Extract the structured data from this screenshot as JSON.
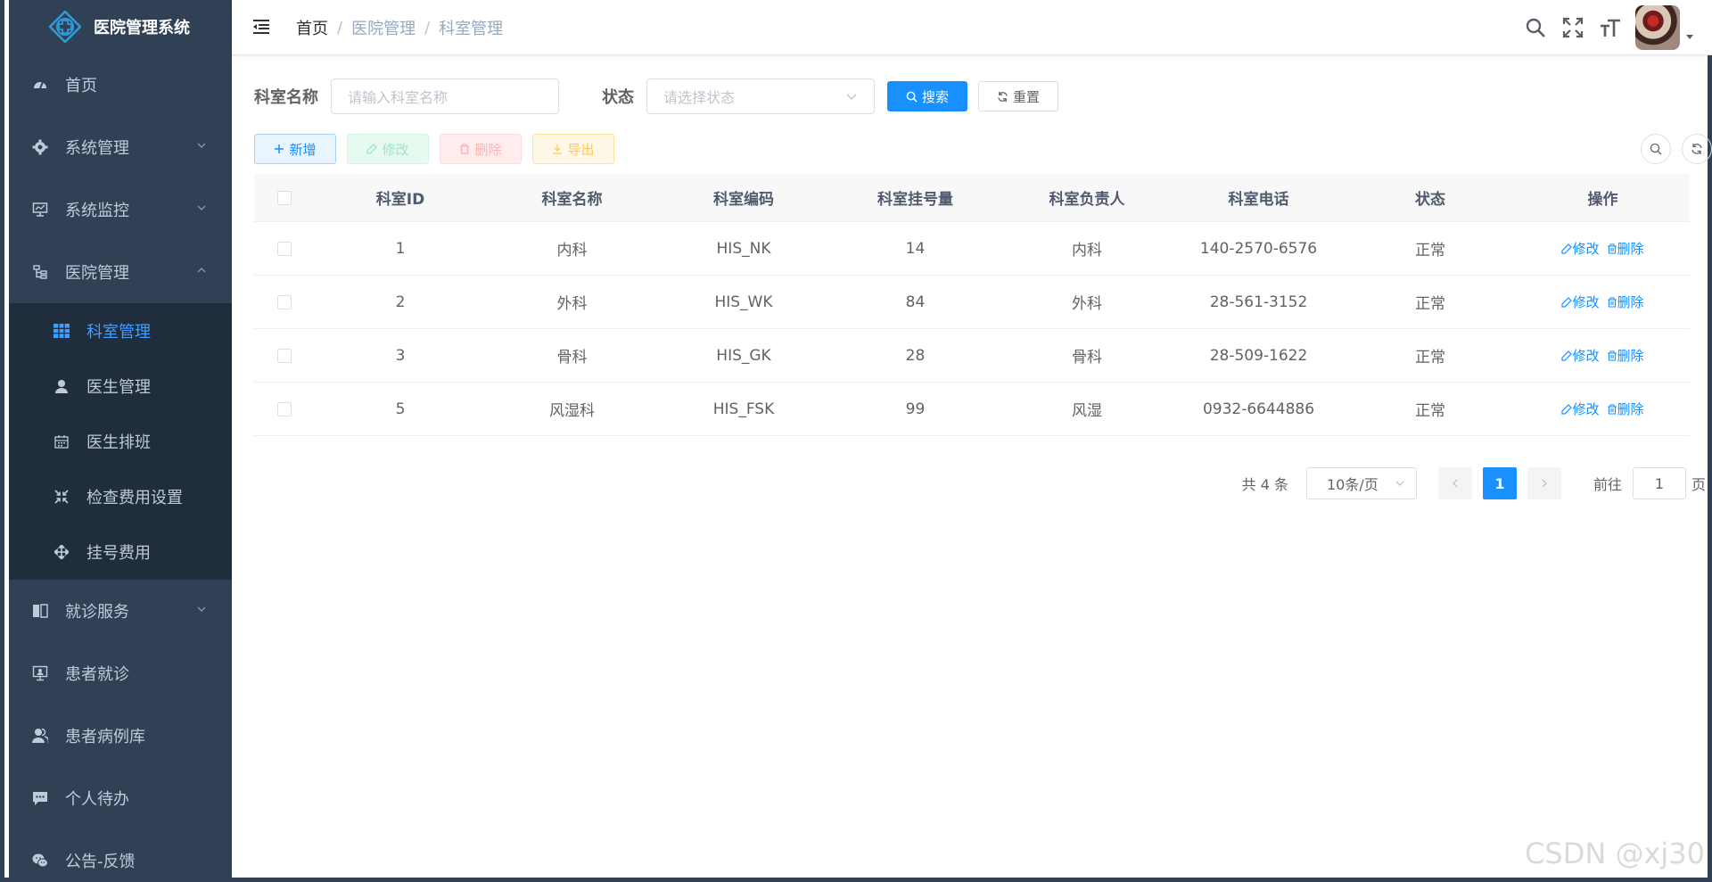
{
  "app": {
    "title": "医院管理系统"
  },
  "sidebar": {
    "items": [
      {
        "label": "首页",
        "icon": "dashboard-icon"
      },
      {
        "label": "系统管理",
        "icon": "gear-icon",
        "expandable": true
      },
      {
        "label": "系统监控",
        "icon": "monitor-icon",
        "expandable": true
      },
      {
        "label": "医院管理",
        "icon": "tree-icon",
        "expandable": true,
        "expanded": true
      },
      {
        "label": "就诊服务",
        "icon": "book-icon",
        "expandable": true
      },
      {
        "label": "患者就诊",
        "icon": "screen-icon"
      },
      {
        "label": "患者病例库",
        "icon": "peoples-icon"
      },
      {
        "label": "个人待办",
        "icon": "message-icon"
      },
      {
        "label": "公告-反馈",
        "icon": "wechat-icon"
      }
    ],
    "submenu": [
      {
        "label": "科室管理",
        "icon": "grid-icon",
        "active": true
      },
      {
        "label": "医生管理",
        "icon": "user-icon"
      },
      {
        "label": "医生排班",
        "icon": "calendar-icon"
      },
      {
        "label": "检查费用设置",
        "icon": "shrink-icon"
      },
      {
        "label": "挂号费用",
        "icon": "move-icon"
      }
    ]
  },
  "breadcrumb": {
    "home": "首页",
    "level1": "医院管理",
    "level2": "科室管理",
    "sep": "/"
  },
  "search": {
    "name_label": "科室名称",
    "name_placeholder": "请输入科室名称",
    "status_label": "状态",
    "status_placeholder": "请选择状态",
    "search_btn": "搜索",
    "reset_btn": "重置"
  },
  "toolbar": {
    "add": "新增",
    "edit": "修改",
    "delete": "删除",
    "export": "导出"
  },
  "table": {
    "headers": [
      "科室ID",
      "科室名称",
      "科室编码",
      "科室挂号量",
      "科室负责人",
      "科室电话",
      "状态",
      "操作"
    ],
    "rows": [
      {
        "id": "1",
        "name": "内科",
        "code": "HIS_NK",
        "count": "14",
        "leader": "内科",
        "phone": "140-2570-6576",
        "status": "正常"
      },
      {
        "id": "2",
        "name": "外科",
        "code": "HIS_WK",
        "count": "84",
        "leader": "外科",
        "phone": "28-561-3152",
        "status": "正常"
      },
      {
        "id": "3",
        "name": "骨科",
        "code": "HIS_GK",
        "count": "28",
        "leader": "骨科",
        "phone": "28-509-1622",
        "status": "正常"
      },
      {
        "id": "5",
        "name": "风湿科",
        "code": "HIS_FSK",
        "count": "99",
        "leader": "风湿",
        "phone": "0932-6644886",
        "status": "正常"
      }
    ],
    "op_edit": "修改",
    "op_delete": "删除"
  },
  "pagination": {
    "total_text": "共 4 条",
    "page_size": "10条/页",
    "current": "1",
    "goto_label": "前往",
    "goto_value": "1",
    "page_suffix": "页"
  },
  "watermark": "CSDN @xj30",
  "colors": {
    "sidebar_bg": "#304156",
    "submenu_bg": "#1f2d3d",
    "primary": "#1890ff",
    "active_menu": "#409eff"
  }
}
